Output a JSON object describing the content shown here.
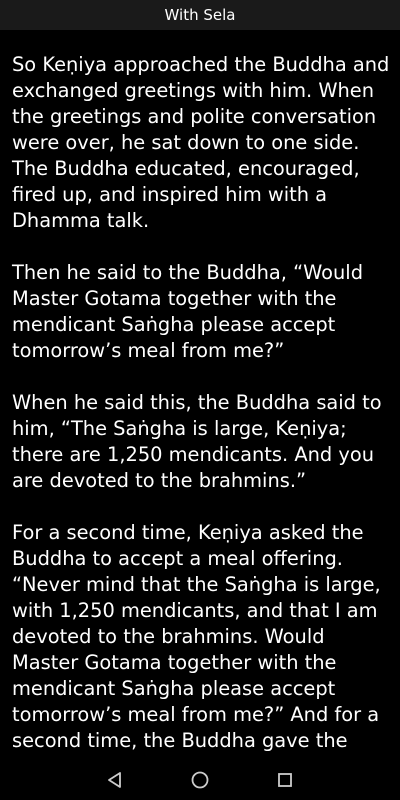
{
  "header": {
    "title": "With Sela"
  },
  "reader": {
    "paragraphs": [
      "So Keṇiya approached the Buddha and exchanged greetings with him. When the greetings and polite conversation were over, he sat down to one side. The Buddha educated, encouraged, fired up, and inspired him with a Dhamma talk.",
      "Then he said to the Buddha, “Would Master Gotama together with the mendicant Saṅgha please accept tomorrow’s meal from me?”",
      "When he said this, the Buddha said to him, “The Saṅgha is large, Keṇiya; there are 1,250 mendicants. And you are devoted to the brahmins.”",
      "For a second time, Keṇiya asked the Buddha to accept a meal offering. “Never mind that the Saṅgha is large, with 1,250 mendicants, and that I am devoted to the brahmins. Would Master Gotama together with the mendicant Saṅgha please accept tomorrow’s meal from me?” And for a second time, the Buddha gave the"
    ]
  },
  "nav_bar": {
    "back_icon": "triangle-back-icon",
    "home_icon": "circle-home-icon",
    "recents_icon": "square-recents-icon"
  },
  "colors": {
    "background": "#000000",
    "text": "#ffffff",
    "status_bar": "#1a1a1a",
    "nav_icons": "#cccccc"
  }
}
